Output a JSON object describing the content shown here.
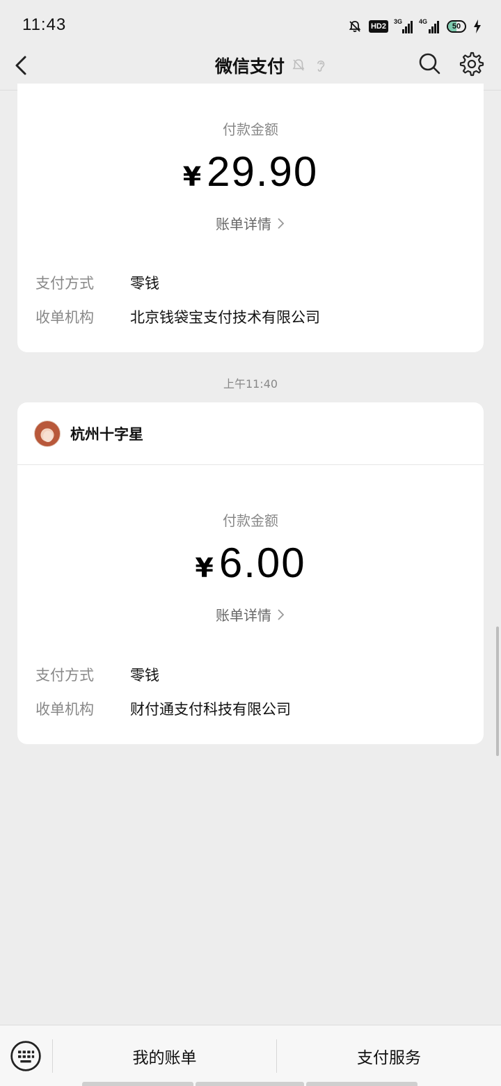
{
  "status_bar": {
    "time": "11:43",
    "hd_label": "HD2",
    "net1": "3G",
    "net2": "4G",
    "battery": "50"
  },
  "nav": {
    "title": "微信支付"
  },
  "cards": [
    {
      "amount_label": "付款金额",
      "currency": "¥",
      "amount": "29.90",
      "detail_link": "账单详情",
      "payment_method_key": "支付方式",
      "payment_method_val": "零钱",
      "acquirer_key": "收单机构",
      "acquirer_val": "北京钱袋宝支付技术有限公司"
    },
    {
      "merchant": "杭州十字星",
      "amount_label": "付款金额",
      "currency": "¥",
      "amount": "6.00",
      "detail_link": "账单详情",
      "payment_method_key": "支付方式",
      "payment_method_val": "零钱",
      "acquirer_key": "收单机构",
      "acquirer_val": "财付通支付科技有限公司"
    }
  ],
  "timestamp": "上午11:40",
  "bottom_bar": {
    "my_bills": "我的账单",
    "pay_services": "支付服务"
  },
  "colors": {
    "background": "#ededed",
    "card": "#ffffff",
    "muted_text": "#888888"
  }
}
